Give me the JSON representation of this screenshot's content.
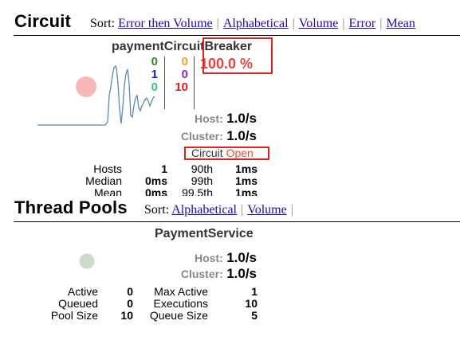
{
  "circuit": {
    "title": "Circuit",
    "sort_label": "Sort:",
    "sort_options": [
      "Error then Volume",
      "Alphabetical",
      "Volume",
      "Error",
      "Mean"
    ],
    "card": {
      "name": "paymentCircuitBreaker",
      "counts_left": [
        "0",
        "1",
        "0"
      ],
      "counts_right": [
        "0",
        "0",
        "10"
      ],
      "counts_left_colors": [
        "#2d8a2d",
        "#1a1ad6",
        "#3cbf8f"
      ],
      "counts_right_colors": [
        "#f0a030",
        "#8a2dbe",
        "#d22222"
      ],
      "error_percent": "100.0 %",
      "host_label": "Host:",
      "host_rate": "1.0/s",
      "cluster_label": "Cluster:",
      "cluster_rate": "1.0/s",
      "circuit_label": "Circuit",
      "circuit_status": "Open",
      "stats": [
        {
          "label": "Hosts",
          "value": "1",
          "p_label": "90th",
          "p_value": "1ms"
        },
        {
          "label": "Median",
          "value": "0ms",
          "p_label": "99th",
          "p_value": "1ms"
        },
        {
          "label": "Mean",
          "value": "0ms",
          "p_label": "99.5th",
          "p_value": "1ms"
        }
      ],
      "colors": {
        "error_red": "#e8433c",
        "status_red": "#e84a3a",
        "circle": "#f8b8b8",
        "sparkline": "#5b88b8"
      }
    }
  },
  "thread_pools": {
    "title": "Thread Pools",
    "sort_label": "Sort:",
    "sort_options": [
      "Alphabetical",
      "Volume"
    ],
    "card": {
      "name": "PaymentService",
      "host_label": "Host:",
      "host_rate": "1.0/s",
      "cluster_label": "Cluster:",
      "cluster_rate": "1.0/s",
      "stats_left": [
        {
          "label": "Active",
          "value": "0"
        },
        {
          "label": "Queued",
          "value": "0"
        },
        {
          "label": "Pool Size",
          "value": "10"
        }
      ],
      "stats_right": [
        {
          "label": "Max Active",
          "value": "1"
        },
        {
          "label": "Executions",
          "value": "10"
        },
        {
          "label": "Queue Size",
          "value": "5"
        }
      ],
      "colors": {
        "circle": "#c8dcc8"
      }
    }
  }
}
